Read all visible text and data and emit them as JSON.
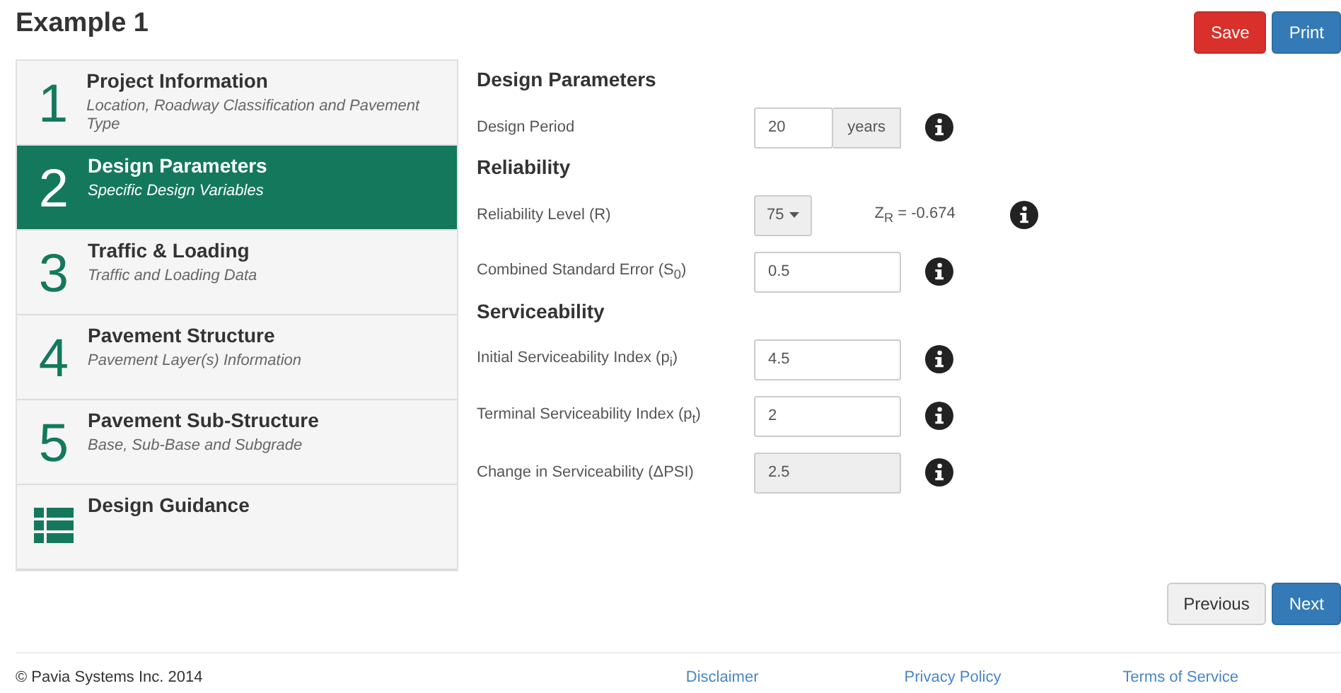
{
  "title": "Example 1",
  "actions": [
    {
      "label": "Save",
      "kind": "danger"
    },
    {
      "label": "Print",
      "kind": "primary"
    }
  ],
  "steps": [
    {
      "number": "1",
      "title": "Project Information",
      "subtitle": "Location, Roadway Classification and Pavement Type",
      "selected": false
    },
    {
      "number": "2",
      "title": "Design Parameters",
      "subtitle": "Specific Design Variables",
      "selected": true
    },
    {
      "number": "3",
      "title": "Traffic & Loading",
      "subtitle": "Traffic and Loading Data",
      "selected": false
    },
    {
      "number": "4",
      "title": "Pavement Structure",
      "subtitle": "Pavement Layer(s) Information",
      "selected": false
    },
    {
      "number": "5",
      "title": "Pavement Sub-Structure",
      "subtitle": "Base, Sub-Base and Subgrade",
      "selected": false
    },
    {
      "kind": "guidance",
      "title": "Design Guidance",
      "selected": false
    }
  ],
  "sections": [
    {
      "heading": "Design Parameters",
      "fields": [
        {
          "label": "Design Period",
          "kind": "input",
          "value": "20",
          "addon": "years",
          "disabled": false
        }
      ]
    },
    {
      "heading": "Reliability",
      "fields": [
        {
          "label": "Reliability Level (R)",
          "kind": "select",
          "value": "75",
          "note": "Z$_{R}$ = -0.674"
        },
        {
          "label": "Combined Standard Error (S$_{0}$)",
          "kind": "input",
          "value": "0.5",
          "disabled": false
        }
      ]
    },
    {
      "heading": "Serviceability",
      "fields": [
        {
          "label": "Initial Serviceability Index (p$_{i}$)",
          "kind": "input",
          "value": "4.5",
          "disabled": false
        },
        {
          "label": "Terminal Serviceability Index (p$_{t}$)",
          "kind": "input",
          "value": "2",
          "disabled": false
        },
        {
          "label": "Change in Serviceability (ΔPSI)",
          "kind": "input",
          "value": "2.5",
          "disabled": true
        }
      ]
    }
  ],
  "nav": [
    {
      "label": "Previous",
      "kind": "default"
    },
    {
      "label": "Next",
      "kind": "primary"
    }
  ],
  "footer": {
    "copyright": "© Pavia Systems Inc. 2014",
    "links": [
      "Disclaimer",
      "Privacy Policy",
      "Terms of Service"
    ]
  }
}
